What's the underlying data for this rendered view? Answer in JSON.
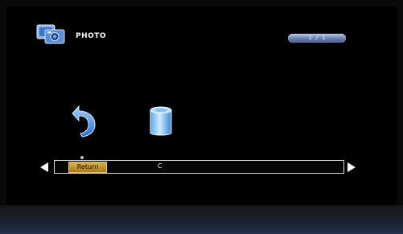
{
  "header": {
    "title": "PHOTO",
    "page_indicator": "1 / 1",
    "icon": "photo-camera-icon"
  },
  "main": {
    "items": [
      {
        "label": "Return",
        "icon": "return-arrow-icon",
        "selected": true
      },
      {
        "label": "C",
        "icon": "storage-drive-icon",
        "selected": false
      }
    ]
  },
  "nav": {
    "left_icon": "left-arrow-icon",
    "right_icon": "right-arrow-icon"
  },
  "colors": {
    "highlight": "#d9b24a",
    "accent_blue": "#6a7fb0",
    "icon_blue": "#3a8fe0"
  }
}
